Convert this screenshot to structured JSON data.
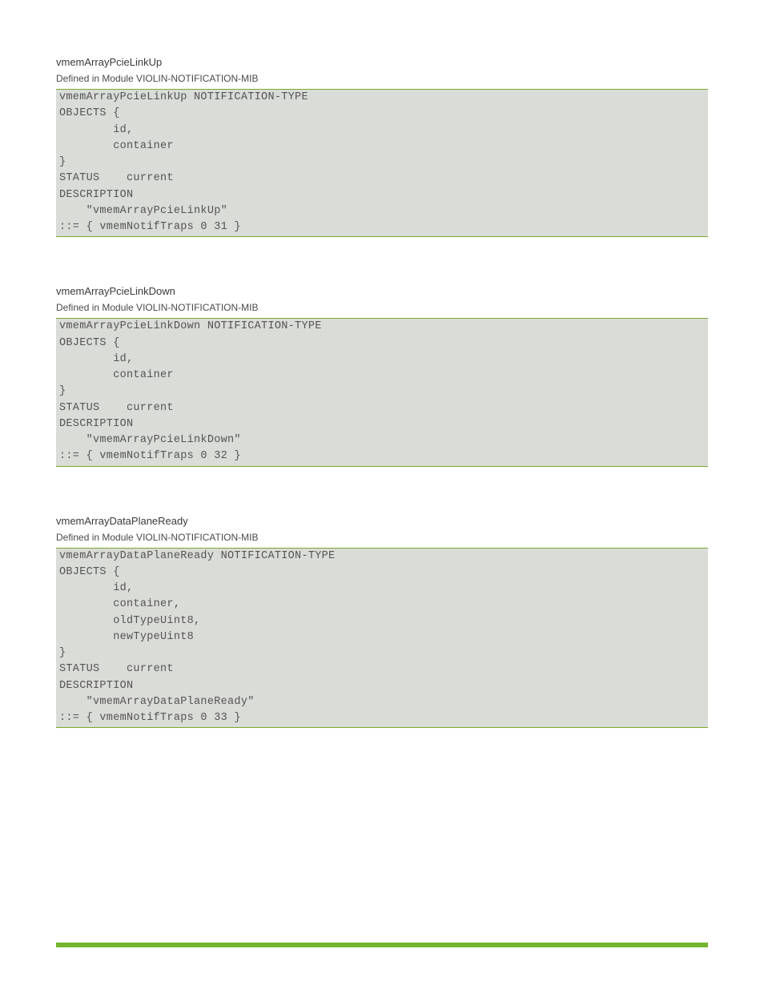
{
  "sections": [
    {
      "heading": "vmemArrayPcieLinkUp",
      "subheading": "Defined in Module VIOLIN-NOTIFICATION-MIB",
      "code": "vmemArrayPcieLinkUp NOTIFICATION-TYPE\nOBJECTS {\n        id,\n        container\n}\nSTATUS    current\nDESCRIPTION\n    \"vmemArrayPcieLinkUp\"\n::= { vmemNotifTraps 0 31 }"
    },
    {
      "heading": "vmemArrayPcieLinkDown",
      "subheading": "Defined in Module VIOLIN-NOTIFICATION-MIB",
      "code": "vmemArrayPcieLinkDown NOTIFICATION-TYPE\nOBJECTS {\n        id,\n        container\n}\nSTATUS    current\nDESCRIPTION\n    \"vmemArrayPcieLinkDown\"\n::= { vmemNotifTraps 0 32 }"
    },
    {
      "heading": "vmemArrayDataPlaneReady",
      "subheading": "Defined in Module VIOLIN-NOTIFICATION-MIB",
      "code": "vmemArrayDataPlaneReady NOTIFICATION-TYPE\nOBJECTS {\n        id,\n        container,\n        oldTypeUint8,\n        newTypeUint8\n}\nSTATUS    current\nDESCRIPTION\n    \"vmemArrayDataPlaneReady\"\n::= { vmemNotifTraps 0 33 }"
    }
  ]
}
